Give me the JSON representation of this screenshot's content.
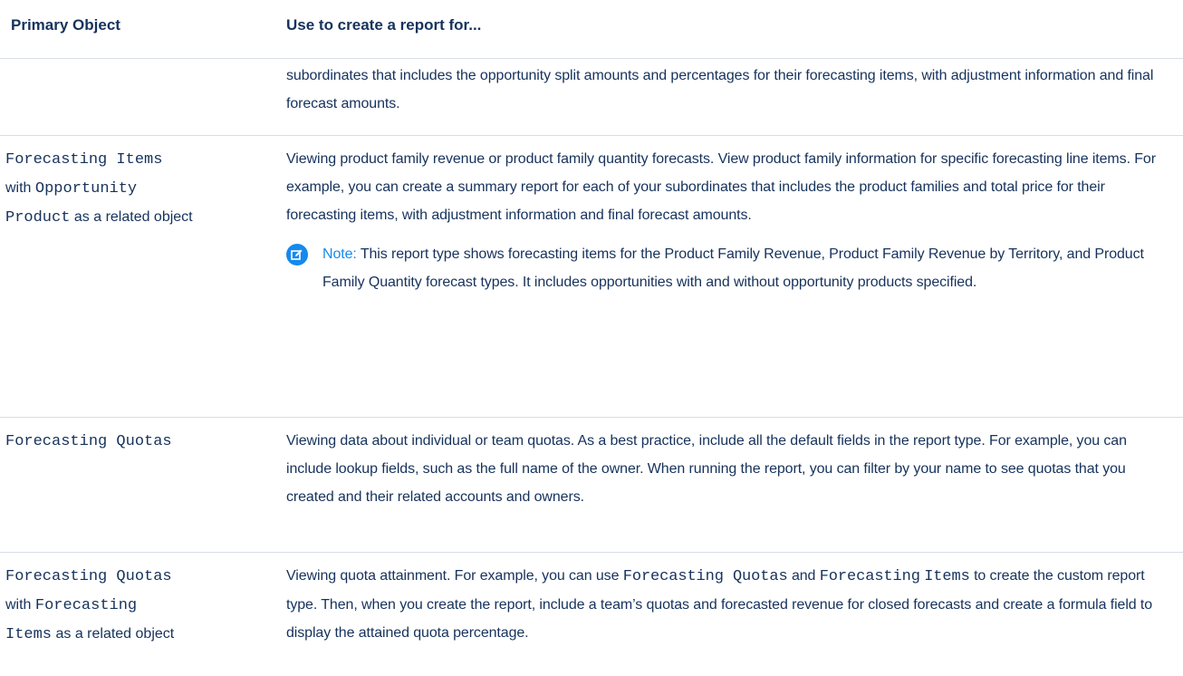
{
  "table": {
    "headers": {
      "primary_object": "Primary Object",
      "use_to_create": "Use to create a report for..."
    },
    "row0": {
      "description": "subordinates that includes the opportunity split amounts and percentages for their forecasting items, with adjustment information and final forecast amounts."
    },
    "row1": {
      "obj_code1": "Forecasting Items",
      "obj_text1": "with",
      "obj_code2": "Opportunity",
      "obj_code3": "Product",
      "obj_text2": "as a related object",
      "description": "Viewing product family revenue or product family quantity forecasts. View product family information for specific forecasting line items. For example, you can create a summary report for each of your subordinates that includes the product families and total price for their forecasting items, with adjustment information and final forecast amounts.",
      "note_label": "Note:",
      "note_text": "This report type shows forecasting items for the Product Family Revenue, Product Family Revenue by Territory, and Product Family Quantity forecast types. It includes opportunities with and without opportunity products specified.",
      "note_icon": "edit-note-icon"
    },
    "row2": {
      "obj_code1": "Forecasting Quotas",
      "description": "Viewing data about individual or team quotas. As a best practice, include all the default fields in the report type. For example, you can include lookup fields, such as the full name of the owner. When running the report, you can filter by your name to see quotas that you created and their related accounts and owners."
    },
    "row3": {
      "obj_code1": "Forecasting Quotas",
      "obj_text1": "with",
      "obj_code2": "Forecasting",
      "obj_code3": "Items",
      "obj_text2": "as a related object",
      "desc_part1": "Viewing quota attainment. For example, you can use",
      "desc_code1": "Forecasting Quotas",
      "desc_part2": "and",
      "desc_code2": "Forecasting",
      "desc_code3": "Items",
      "desc_part3": "to create the custom report type. Then, when you create the report, include a team’s quotas and forecasted revenue for closed forecasts and create a formula field to display the attained quota percentage."
    }
  },
  "colors": {
    "text": "#16325c",
    "accent": "#1589ee",
    "divider": "#d8dde6"
  }
}
